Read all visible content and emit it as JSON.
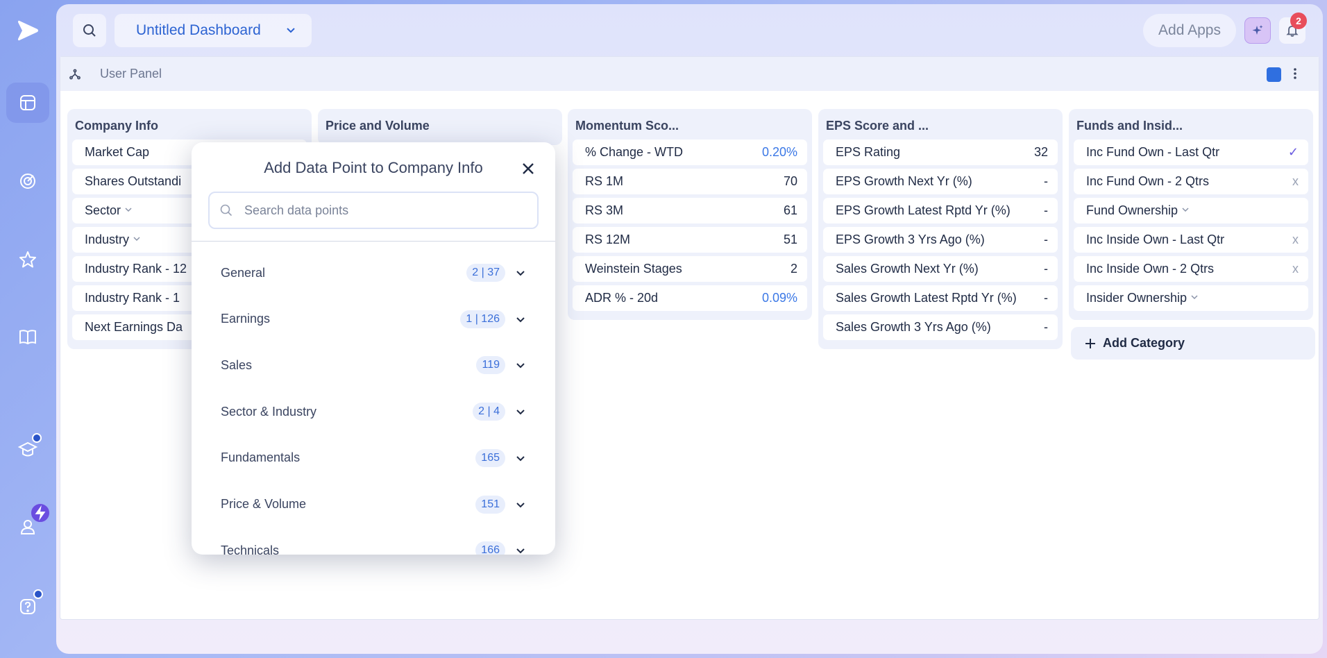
{
  "sidebar": {
    "items": [
      {
        "icon": "dashboard-icon",
        "active": true
      },
      {
        "icon": "radar-icon",
        "active": false
      },
      {
        "icon": "star-icon",
        "active": false
      },
      {
        "icon": "book-icon",
        "active": false
      },
      {
        "icon": "graduation-cap-icon",
        "active": false
      },
      {
        "icon": "user-icon",
        "active": false
      },
      {
        "icon": "help-icon",
        "active": false
      }
    ]
  },
  "topbar": {
    "dashboard_title": "Untitled Dashboard",
    "add_apps_label": "Add Apps",
    "notification_count": "2"
  },
  "panel": {
    "label": "User Panel"
  },
  "columns": [
    {
      "title": "Company Info",
      "rows": [
        {
          "label": "Market Cap",
          "value": ""
        },
        {
          "label": "Shares Outstandi",
          "value": ""
        },
        {
          "label": "Sector",
          "value": "",
          "dropdown": true
        },
        {
          "label": "Industry",
          "value": "",
          "dropdown": true
        },
        {
          "label": "Industry Rank - 12",
          "value": ""
        },
        {
          "label": "Industry Rank - 1",
          "value": ""
        },
        {
          "label": "Next Earnings Da",
          "value": ""
        }
      ]
    },
    {
      "title": "Price and Volume",
      "rows": []
    },
    {
      "title": "Momentum Sco...",
      "rows": [
        {
          "label": "% Change - WTD",
          "value": "0.20%",
          "style": "blue"
        },
        {
          "label": "RS 1M",
          "value": "70"
        },
        {
          "label": "RS 3M",
          "value": "61"
        },
        {
          "label": "RS 12M",
          "value": "51"
        },
        {
          "label": "Weinstein Stages",
          "value": "2"
        },
        {
          "label": "ADR % - 20d",
          "value": "0.09%",
          "style": "blue"
        }
      ]
    },
    {
      "title": "EPS Score and ...",
      "rows": [
        {
          "label": "EPS Rating",
          "value": "32"
        },
        {
          "label": "EPS Growth Next Yr (%)",
          "value": "-"
        },
        {
          "label": "EPS Growth Latest Rptd Yr (%)",
          "value": "-"
        },
        {
          "label": "EPS Growth 3 Yrs Ago (%)",
          "value": "-"
        },
        {
          "label": "Sales Growth Next Yr (%)",
          "value": "-"
        },
        {
          "label": "Sales Growth Latest Rptd Yr (%)",
          "value": "-"
        },
        {
          "label": "Sales Growth 3 Yrs Ago (%)",
          "value": "-"
        }
      ]
    },
    {
      "title": "Funds and Insid...",
      "rows": [
        {
          "label": "Inc Fund Own - Last Qtr",
          "value": "✓",
          "style": "check"
        },
        {
          "label": "Inc Fund Own - 2 Qtrs",
          "value": "x",
          "style": "x"
        },
        {
          "label": "Fund Ownership",
          "value": "",
          "dropdown": true
        },
        {
          "label": "Inc Inside Own - Last Qtr",
          "value": "x",
          "style": "x"
        },
        {
          "label": "Inc Inside Own - 2 Qtrs",
          "value": "x",
          "style": "x"
        },
        {
          "label": "Insider Ownership",
          "value": "",
          "dropdown": true
        }
      ]
    }
  ],
  "add_category_label": "Add Category",
  "modal": {
    "title": "Add Data Point to Company Info",
    "search_placeholder": "Search data points",
    "categories": [
      {
        "name": "General",
        "count": "2 | 37"
      },
      {
        "name": "Earnings",
        "count": "1 | 126"
      },
      {
        "name": "Sales",
        "count": "119"
      },
      {
        "name": "Sector & Industry",
        "count": "2 | 4"
      },
      {
        "name": "Fundamentals",
        "count": "165"
      },
      {
        "name": "Price & Volume",
        "count": "151"
      },
      {
        "name": "Technicals",
        "count": "166"
      }
    ]
  },
  "colors": {
    "accent": "#2c63d2",
    "badge": "#e84d5b",
    "value_blue": "#3b78e6"
  }
}
